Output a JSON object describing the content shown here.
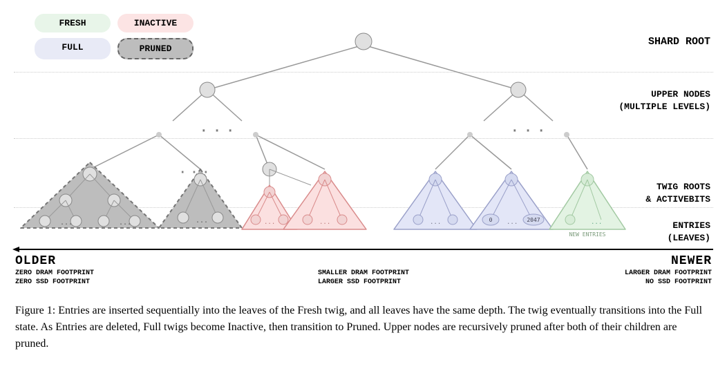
{
  "legend": {
    "fresh": "FRESH",
    "inactive": "INACTIVE",
    "full": "FULL",
    "pruned": "PRUNED"
  },
  "labels": {
    "shard_root": "SHARD ROOT",
    "upper_nodes_l1": "UPPER NODES",
    "upper_nodes_l2": "(MULTIPLE LEVELS)",
    "twig_roots_l1": "TWIG ROOTS",
    "twig_roots_l2": "& ACTIVEBITS",
    "entries_l1": "ENTRIES",
    "entries_l2": "(LEAVES)"
  },
  "timeline": {
    "older_title": "OLDER",
    "older_line1": "ZERO DRAM FOOTPRINT",
    "older_line2": "ZERO SSD FOOTPRINT",
    "mid_line1": "SMALLER DRAM FOOTPRINT",
    "mid_line2": "LARGER SSD FOOTPRINT",
    "newer_title": "NEWER",
    "newer_line1": "LARGER DRAM FOOTPRINT",
    "newer_line2": "NO SSD FOOTPRINT"
  },
  "twig_details": {
    "full_left_val": "0",
    "full_right_val": "2047",
    "new_entries_label": "NEW ENTRIES"
  },
  "caption": "Figure 1: Entries are inserted sequentially into the leaves of the Fresh twig, and all leaves have the same depth. The twig eventually transitions into the Full state. As Entries are deleted, Full twigs become Inactive, then transition to Pruned. Upper nodes are recursively pruned after both of their children are pruned.",
  "colors": {
    "pruned_fill": "#bdbdbd",
    "pruned_stroke": "#757575",
    "inactive_fill": "#fbe0e0",
    "inactive_stroke": "#d98b8b",
    "full_fill": "#e3e6f7",
    "full_stroke": "#9aa0c9",
    "fresh_fill": "#e3f3e3",
    "fresh_stroke": "#a2c9a2",
    "node_fill": "#e0e0e0",
    "node_stroke": "#888",
    "edge": "#999"
  }
}
